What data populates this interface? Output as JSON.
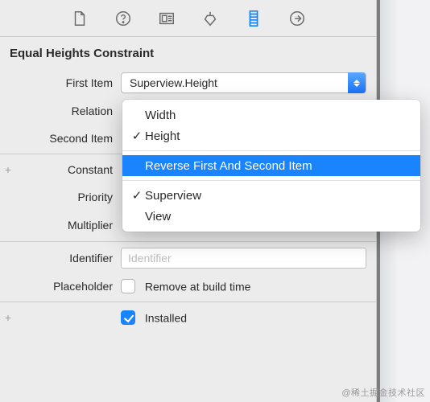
{
  "section_title": "Equal Heights Constraint",
  "rows": {
    "first_item": {
      "label": "First Item",
      "value": "Superview.Height"
    },
    "relation": {
      "label": "Relation"
    },
    "second_item": {
      "label": "Second Item"
    },
    "constant": {
      "label": "Constant"
    },
    "priority": {
      "label": "Priority"
    },
    "multiplier": {
      "label": "Multiplier"
    },
    "identifier": {
      "label": "Identifier",
      "placeholder": "Identifier",
      "value": ""
    },
    "placeholder_row": {
      "label": "Placeholder",
      "checkbox_label": "Remove at build time"
    },
    "installed": {
      "checkbox_label": "Installed"
    }
  },
  "menu": {
    "group1": [
      {
        "label": "Width",
        "checked": false
      },
      {
        "label": "Height",
        "checked": true
      }
    ],
    "highlight": "Reverse First And Second Item",
    "group2": [
      {
        "label": "Superview",
        "checked": true
      },
      {
        "label": "View",
        "checked": false
      }
    ]
  },
  "watermark": "@稀土掘金技术社区"
}
